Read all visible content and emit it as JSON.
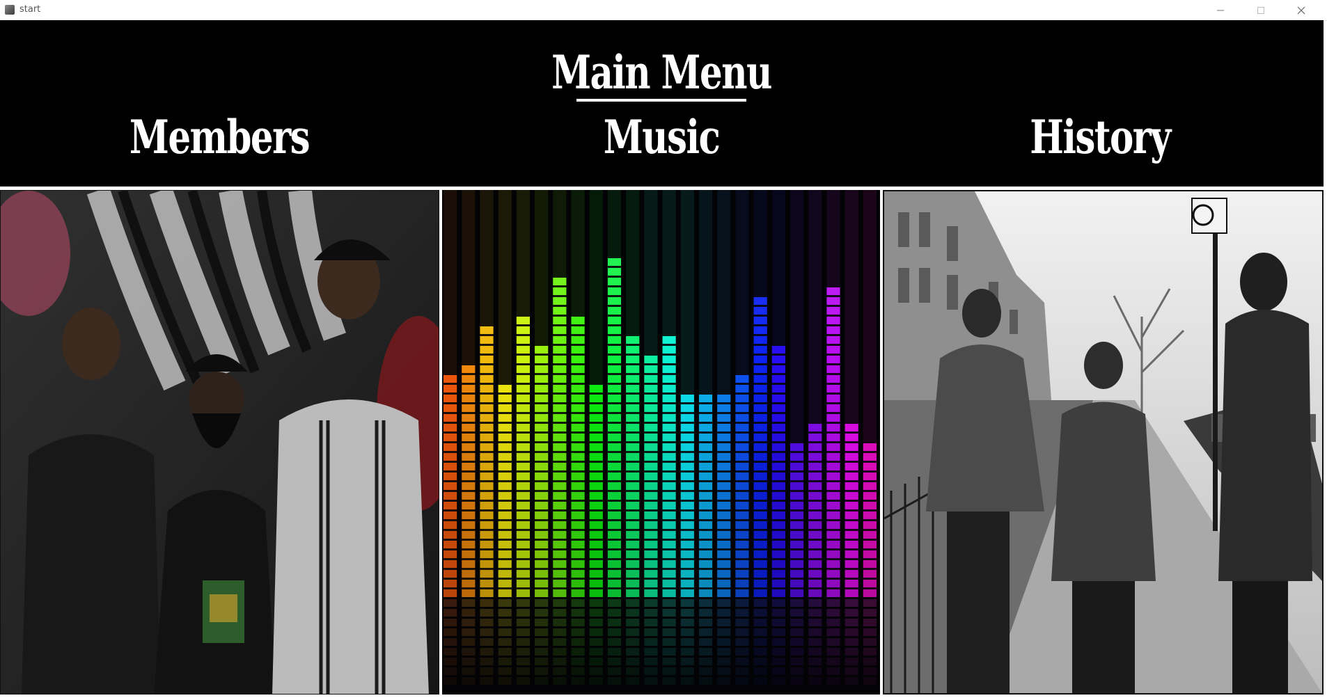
{
  "window": {
    "title": "start",
    "controls": [
      "minimize",
      "maximize",
      "close"
    ]
  },
  "header": {
    "title": "Main Menu",
    "nav": [
      {
        "label": "Members"
      },
      {
        "label": "Music"
      },
      {
        "label": "History"
      }
    ]
  },
  "panels": [
    {
      "name": "members-photo",
      "description_icon": "group-photo-graffiti"
    },
    {
      "name": "music-equalizer",
      "description_icon": "rainbow-equalizer"
    },
    {
      "name": "history-photo",
      "description_icon": "street-photo-bw"
    }
  ],
  "colors": {
    "header_bg": "#000000",
    "header_text": "#ffffff",
    "window_bg": "#ffffff"
  },
  "equalizer": {
    "levels": [
      0.62,
      0.65,
      0.78,
      0.6,
      0.79,
      0.72,
      0.91,
      0.79,
      0.6,
      0.95,
      0.74,
      0.7,
      0.73,
      0.57,
      0.57,
      0.59,
      0.63,
      0.85,
      0.72,
      0.44,
      0.5,
      0.89,
      0.5,
      0.44
    ]
  }
}
